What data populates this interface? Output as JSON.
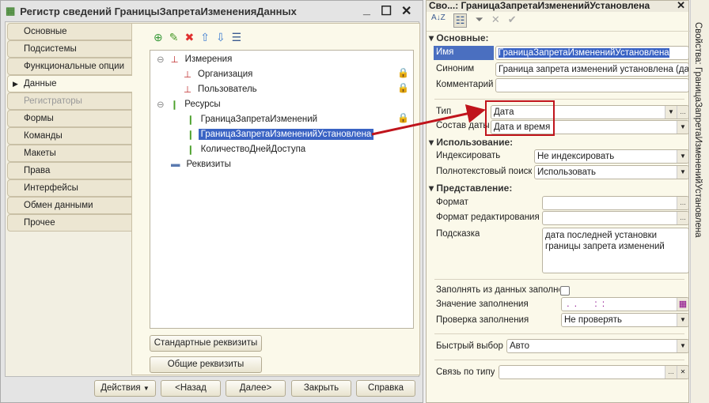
{
  "left_window": {
    "title": "Регистр сведений ГраницыЗапретаИзмененияДанных",
    "tabs": [
      "Основные",
      "Подсистемы",
      "Функциональные опции",
      "Данные",
      "Регистраторы",
      "Формы",
      "Команды",
      "Макеты",
      "Права",
      "Интерфейсы",
      "Обмен данными",
      "Прочее"
    ],
    "tree": {
      "dimensions": "Измерения",
      "dim_items": [
        "Организация",
        "Пользователь"
      ],
      "resources": "Ресурсы",
      "res_items": [
        "ГраницаЗапретаИзменений",
        "ГраницаЗапретаИзмененийУстановлена",
        "КоличествоДнейДоступа"
      ],
      "attributes": "Реквизиты"
    },
    "std_attrs": "Стандартные реквизиты",
    "common_attrs": "Общие реквизиты",
    "footer": {
      "actions": "Действия",
      "back": "<Назад",
      "next": "Далее>",
      "close": "Закрыть",
      "help": "Справка"
    }
  },
  "properties": {
    "title": "Сво...: ГраницаЗапретаИзмененийУстановлена",
    "vertical_tab": "Свойства: ГраницаЗапретаИзмененийУстановлена",
    "sections": {
      "main": "Основные:",
      "usage": "Использование:",
      "view": "Представление:"
    },
    "name_label": "Имя",
    "name": "ГраницаЗапретаИзмененийУстановлена",
    "synonym_label": "Синоним",
    "synonym": "Граница запрета изменений установлена (дата",
    "comment_label": "Комментарий",
    "comment": "",
    "type_label": "Тип",
    "type": "Дата",
    "date_parts_label": "Состав даты",
    "date_parts": "Дата и время",
    "index_label": "Индексировать",
    "index": "Не индексировать",
    "fulltext_label": "Полнотекстовый поиск",
    "fulltext": "Использовать",
    "format_label": "Формат",
    "format": "",
    "edit_format_label": "Формат редактирования",
    "edit_format": "",
    "tooltip_label": "Подсказка",
    "tooltip": "дата последней установки границы запрета изменений",
    "fill_from_label": "Заполнять из данных заполне",
    "fill_from": false,
    "fill_value_label": "Значение заполнения",
    "fill_value": " .  .       :  :",
    "fill_check_label": "Проверка заполнения",
    "fill_check": "Не проверять",
    "quick_choice_label": "Быстрый выбор",
    "quick_choice": "Авто",
    "type_link_label": "Связь по типу",
    "type_link": ""
  },
  "colors": {
    "accent": "#3a63c4",
    "highlight": "#c0141c"
  }
}
